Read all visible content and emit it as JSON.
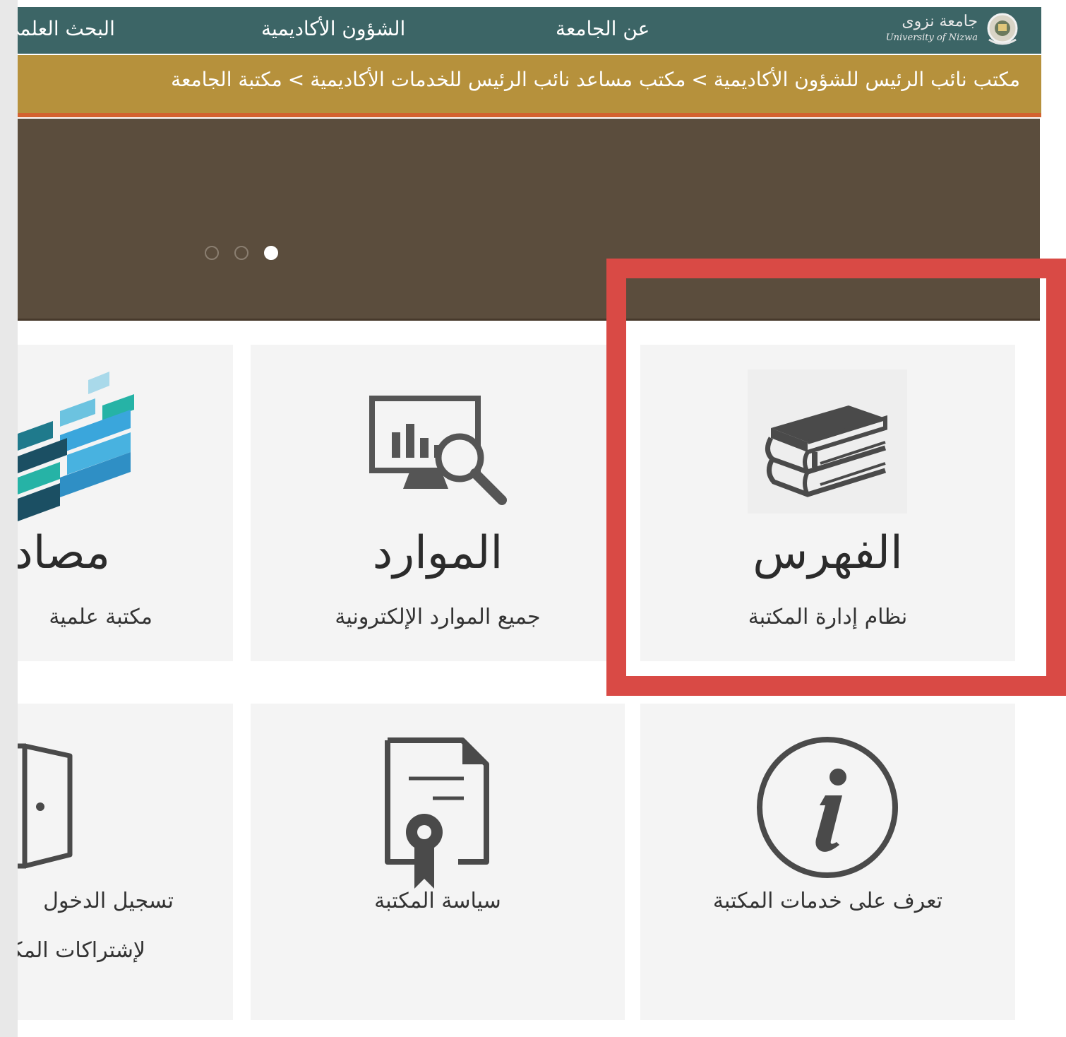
{
  "nav": {
    "items": [
      "البحث العلمي",
      "الشؤون الأكاديمية",
      "عن الجامعة"
    ],
    "logo_text": "جامعة نزوى",
    "logo_latin": "University of Nizwa"
  },
  "breadcrumb": {
    "items": [
      "مكتب نائب الرئيس للشؤون الأكاديمية",
      "مكتب مساعد نائب الرئيس للخدمات الأكاديمية",
      "مكتبة الجامعة"
    ],
    "separator": ">"
  },
  "slider": {
    "dots": 3,
    "active_dot": 3
  },
  "tiles": [
    {
      "title": "الفهرس",
      "subtitle": "نظام إدارة المكتبة",
      "icon": "books-stack-icon"
    },
    {
      "title": "الموارد",
      "subtitle": "جميع الموارد الإلكترونية",
      "icon": "monitor-analytics-icon"
    },
    {
      "title": "مصادر",
      "subtitle": "مكتبة علمية",
      "icon": "database-blocks-icon"
    },
    {
      "title": "",
      "subtitle": "تعرف على خدمات المكتبة",
      "icon": "info-icon"
    },
    {
      "title": "",
      "subtitle": "سياسة المكتبة",
      "icon": "certificate-icon"
    },
    {
      "title": "",
      "subtitle": "تسجيل الدخول",
      "subtitle2": "لإشتراكات المكتبة",
      "icon": "door-icon"
    }
  ],
  "colors": {
    "nav_bg": "#3c6566",
    "breadcrumb_bg": "#b6913c",
    "breadcrumb_border": "#d4622f",
    "slider_bg": "#5b4d3d",
    "highlight": "#d94a45",
    "tile_bg": "#f4f4f4"
  }
}
